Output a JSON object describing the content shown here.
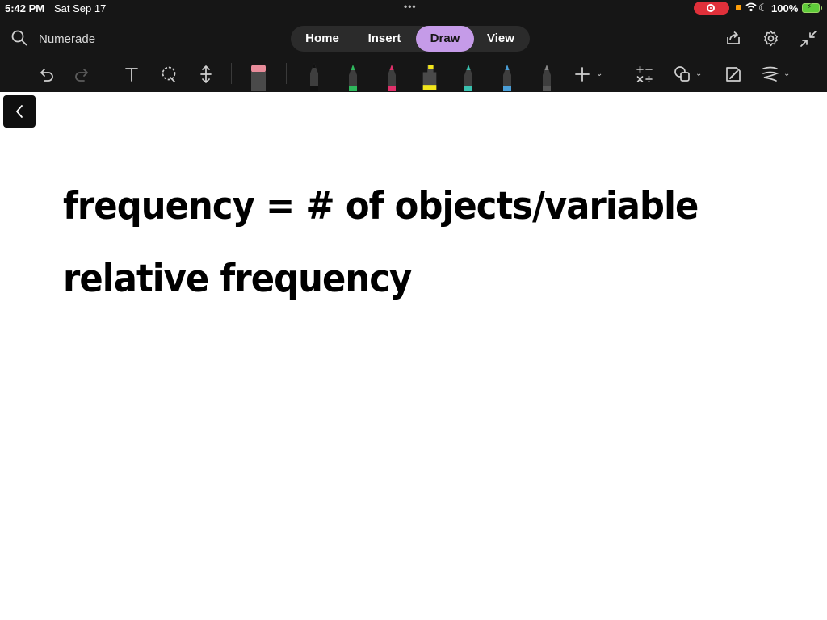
{
  "status_bar": {
    "time": "5:42 PM",
    "date": "Sat Sep 17",
    "battery": "100%"
  },
  "header": {
    "app_title": "Numerade",
    "tabs": [
      {
        "label": "Home",
        "active": false
      },
      {
        "label": "Insert",
        "active": false
      },
      {
        "label": "Draw",
        "active": true
      },
      {
        "label": "View",
        "active": false
      }
    ]
  },
  "toolbar": {
    "tools": [
      "undo-icon",
      "redo-icon",
      "text-icon",
      "lasso-icon",
      "insert-space-icon",
      "eraser-icon"
    ],
    "pens": [
      {
        "name": "black-pen",
        "color": "#1a1a1a"
      },
      {
        "name": "green-pen",
        "color": "#2eb85c"
      },
      {
        "name": "pink-pen",
        "color": "#e0306a"
      },
      {
        "name": "yellow-highlighter",
        "color": "#f2e61b"
      },
      {
        "name": "teal-pen",
        "color": "#3ac2b0"
      },
      {
        "name": "blue-pen",
        "color": "#4a9fd8"
      },
      {
        "name": "gray-pen",
        "color": "#777777"
      }
    ],
    "right_tools": [
      "add-pen-icon",
      "math-icon",
      "shapes-icon",
      "ink-to-shape-icon",
      "line-style-icon"
    ]
  },
  "colors": {
    "accent": "#c59be8",
    "toolbar_bg": "#161616",
    "record": "#e0303a"
  },
  "canvas": {
    "lines": [
      "frequency = # of objects/variable",
      "relative frequency"
    ]
  }
}
